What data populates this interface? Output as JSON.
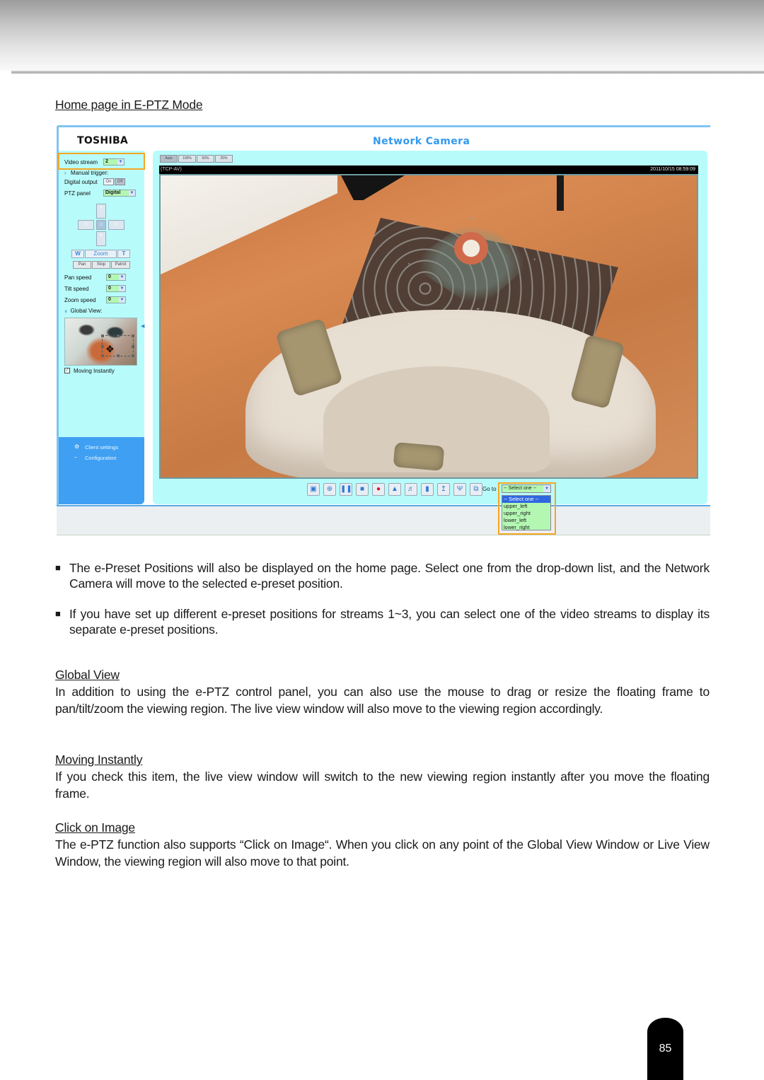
{
  "document": {
    "section_title": "Home page in E-PTZ Mode",
    "page_number": "85"
  },
  "camera_ui": {
    "brand": "TOSHIBA",
    "title": "Network Camera",
    "left_panel": {
      "video_stream_label": "Video stream",
      "video_stream_value": "2",
      "manual_trigger_label": "Manual trigger:",
      "digital_output_label": "Digital output",
      "digital_output_on": "On",
      "digital_output_off": "Off",
      "ptz_panel_label": "PTZ panel",
      "ptz_panel_value": "Digital",
      "zoom_wide": "W",
      "zoom_label": "Zoom",
      "zoom_tele": "T",
      "pan_button": "Pan",
      "stop_button": "Stop",
      "patrol_button": "Patrol",
      "pan_speed_label": "Pan speed",
      "pan_speed_value": "0",
      "tilt_speed_label": "Tilt speed",
      "tilt_speed_value": "0",
      "zoom_speed_label": "Zoom speed",
      "zoom_speed_value": "0",
      "global_view_label": "Global View:",
      "moving_instantly_label": "Moving Instantly",
      "moving_instantly_checked": true,
      "client_settings": "Client settings",
      "configuration": "Configuration"
    },
    "view_size_buttons": [
      "Auto",
      "100%",
      "50%",
      "25%"
    ],
    "video": {
      "protocol": "(TCP-AV)",
      "timestamp": "2011/10/15  08:59:09"
    },
    "toolbar_icons": [
      "snapshot-icon",
      "digital-zoom-icon",
      "pause-icon",
      "stop-icon",
      "record-icon",
      "volume-icon",
      "speaker-icon",
      "talk-icon",
      "upload-icon",
      "microphone-icon",
      "fullscreen-icon"
    ],
    "goto_label": "Go to",
    "preset_select_value": "-- Select one --",
    "preset_options": [
      "-- Select one --",
      "upper_left",
      "upper_right",
      "lower_left",
      "lower_right"
    ]
  },
  "bullets": [
    "The e-Preset Positions will also be displayed on the home page. Select one from the drop-down list, and the Network Camera will move to the selected e-preset position.",
    "If you have set up different e-preset positions for streams 1~3, you can select one of the video streams to display its separate e-preset positions."
  ],
  "sections": [
    {
      "heading": "Global View",
      "body": "In addition to using the e-PTZ control panel, you can also use the mouse to drag or resize the floating frame to pan/tilt/zoom the viewing region. The live view window will also move to the viewing region accordingly."
    },
    {
      "heading": "Moving Instantly",
      "body": "If you check this item, the live view window will switch to the new viewing region instantly after you move the floating frame."
    },
    {
      "heading": "Click on Image",
      "body": "The e-PTZ function also supports “Click on Image“. When you click on any point of the Global View Window or Live View Window, the viewing region will also move to that point."
    }
  ],
  "bullet_mark": "■"
}
